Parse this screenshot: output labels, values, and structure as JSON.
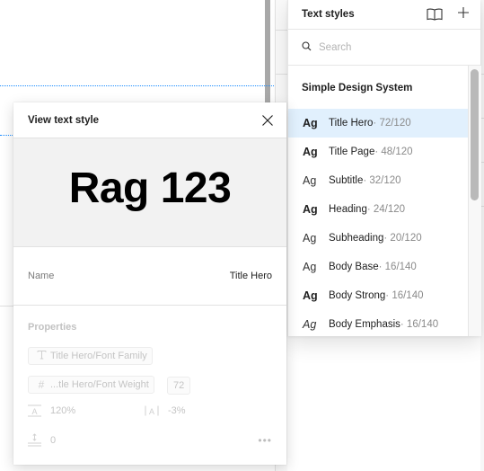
{
  "text_styles_panel": {
    "title": "Text styles",
    "library_icon": "book-open-icon",
    "add_icon": "plus-icon",
    "search": {
      "placeholder": "Search",
      "value": ""
    },
    "group_name": "Simple Design System",
    "items": [
      {
        "preview": "Ag",
        "weight": "bold",
        "name": "Title Hero",
        "meta": " · 72/120",
        "selected": true
      },
      {
        "preview": "Ag",
        "weight": "bold",
        "name": "Title Page",
        "meta": " · 48/120",
        "selected": false
      },
      {
        "preview": "Ag",
        "weight": "regular",
        "name": "Subtitle",
        "meta": " · 32/120",
        "selected": false
      },
      {
        "preview": "Ag",
        "weight": "bold",
        "name": "Heading",
        "meta": " · 24/120",
        "selected": false
      },
      {
        "preview": "Ag",
        "weight": "regular",
        "name": "Subheading",
        "meta": " · 20/120",
        "selected": false
      },
      {
        "preview": "Ag",
        "weight": "regular",
        "name": "Body Base",
        "meta": " · 16/140",
        "selected": false
      },
      {
        "preview": "Ag",
        "weight": "bold",
        "name": "Body Strong",
        "meta": " · 16/140",
        "selected": false
      },
      {
        "preview": "Ag",
        "weight": "italic",
        "name": "Body Emphasis",
        "meta": " · 16/140",
        "selected": false
      }
    ],
    "selected_color": "#e1f0fd"
  },
  "dialog": {
    "title": "View text style",
    "close_icon": "close-icon",
    "preview_text": "Rag 123",
    "name_label": "Name",
    "name_value": "Title Hero",
    "properties_label": "Properties",
    "font_family_variable": "Title Hero/Font Family",
    "font_weight_variable": "...tle Hero/Font Weight",
    "font_size": "72",
    "line_height": "120%",
    "letter_spacing": "-3%",
    "paragraph_spacing": "0",
    "more_label": "•••"
  },
  "colors": {
    "selection_guide": "#1a8cff"
  }
}
